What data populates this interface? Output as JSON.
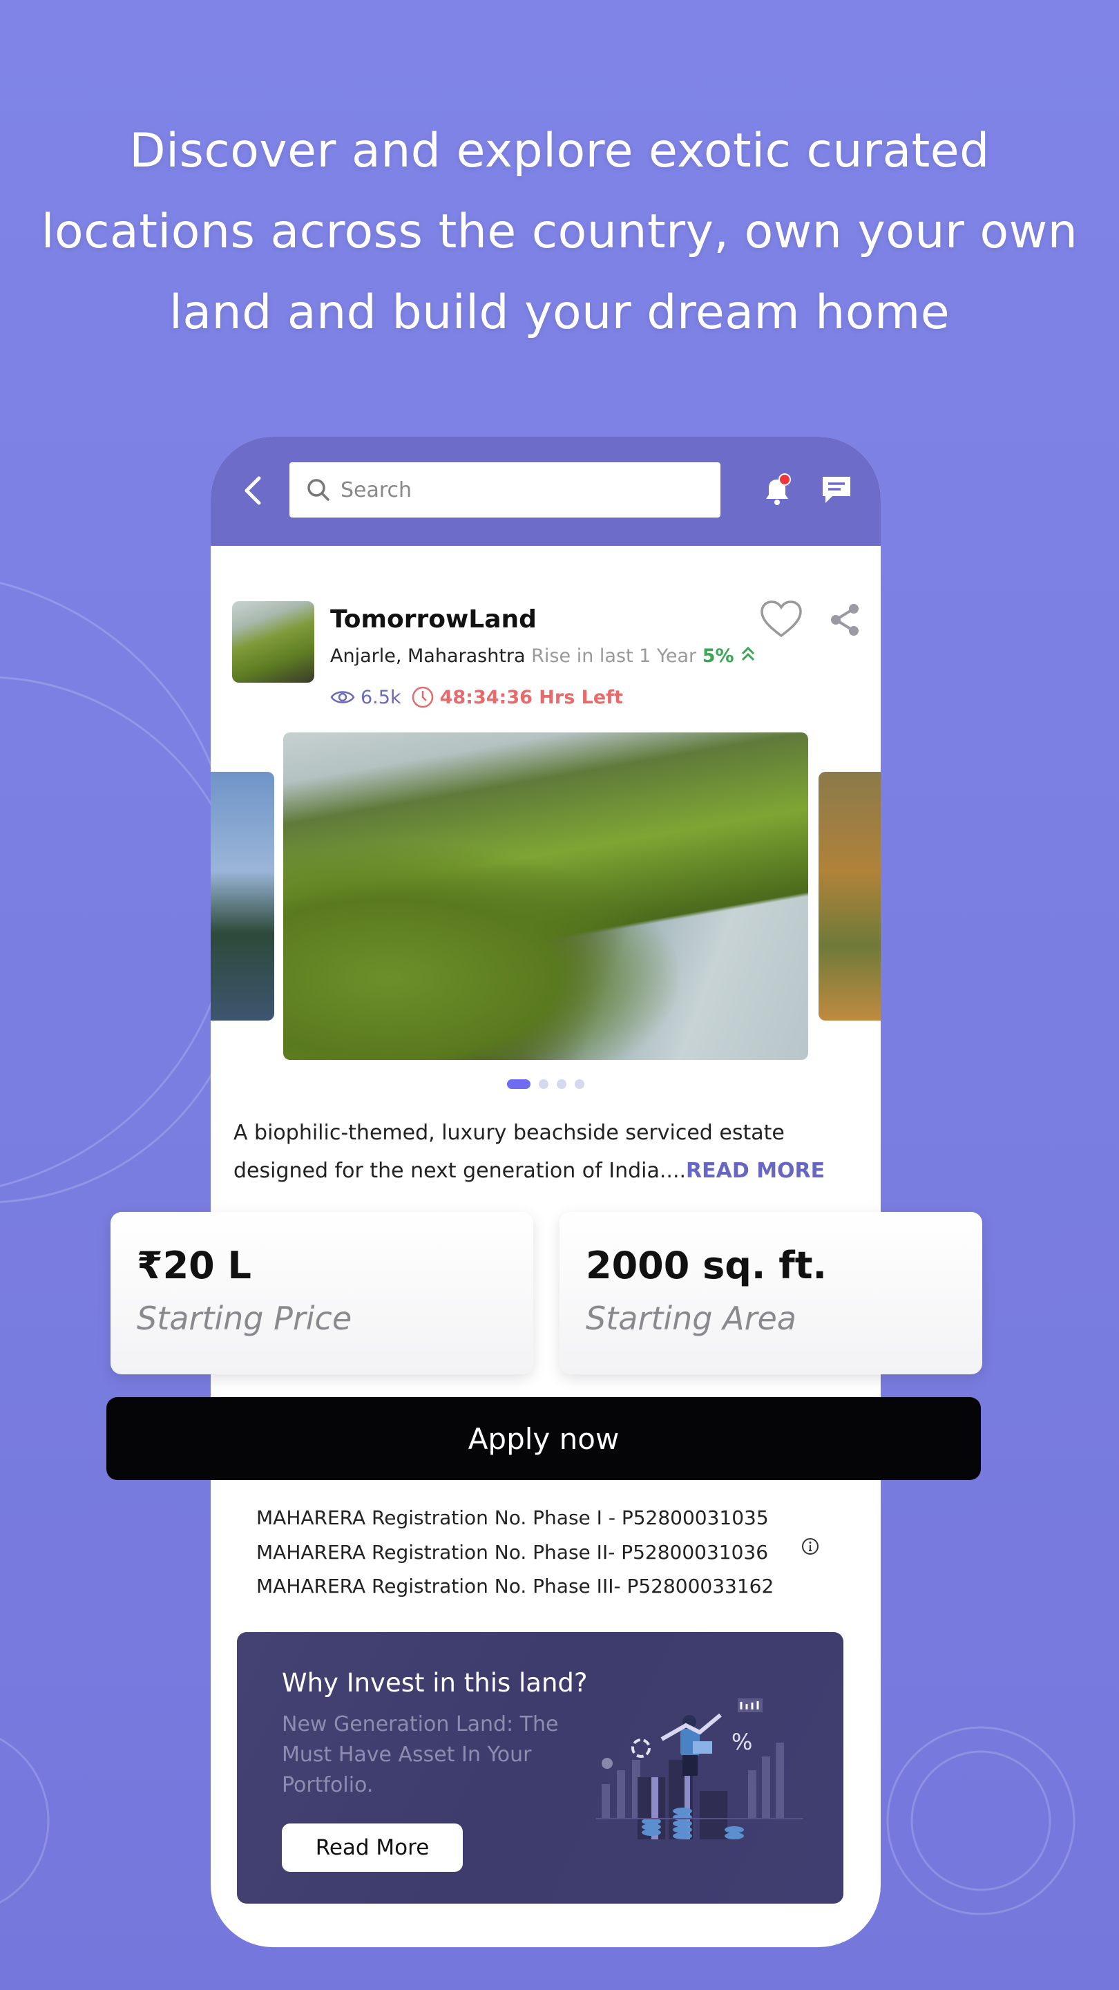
{
  "headline": [
    "Discover and explore exotic curated",
    "locations across the country, own your own",
    "land and build your dream home"
  ],
  "header": {
    "search_placeholder": "Search",
    "back_icon": "chevron-left-icon",
    "notification_icon": "bell-icon",
    "chat_icon": "chat-icon",
    "notification_badge_color": "#f0353d"
  },
  "property": {
    "title": "TomorrowLand",
    "location": "Anjarle, Maharashtra",
    "rise_label": "Rise in last 1 Year",
    "rise_value": "5%",
    "views": "6.5k",
    "time_left": "48:34:36 Hrs Left"
  },
  "carousel": {
    "total": 4,
    "active": 1
  },
  "description": {
    "text": "A biophilic-themed, luxury beachside serviced estate designed for the next generation of India....",
    "read_more": "READ MORE"
  },
  "stats": [
    {
      "value": "₹20 L",
      "label": "Starting Price"
    },
    {
      "value": "2000 sq. ft.",
      "label": "Starting Area"
    }
  ],
  "apply_label": "Apply now",
  "registrations": [
    "MAHARERA Registration No. Phase I - P52800031035",
    "MAHARERA Registration No. Phase II- P52800031036",
    "MAHARERA Registration No. Phase III- P52800033162"
  ],
  "invest": {
    "title": "Why Invest in this land?",
    "subtitle": "New Generation Land: The Must Have Asset In Your Portfolio.",
    "button": "Read More"
  },
  "colors": {
    "background": "#7b7fe3",
    "header": "#6e6cc9",
    "accent": "#6766c3",
    "rise": "#3aa757",
    "timer": "#e86a6a",
    "apply": "#050508",
    "invest_card": "#413f6f"
  }
}
